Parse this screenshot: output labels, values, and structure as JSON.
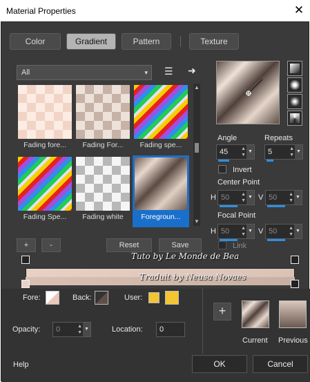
{
  "window": {
    "title": "Material Properties",
    "close_label": "✕"
  },
  "tabs": [
    {
      "label": "Color",
      "selected": false
    },
    {
      "label": "Gradient",
      "selected": true
    },
    {
      "label": "Pattern",
      "selected": false
    },
    {
      "label": "Texture",
      "selected": false
    }
  ],
  "category": {
    "value": "All",
    "caret": "▾"
  },
  "icons": {
    "library": "☰",
    "arrow": "➜"
  },
  "thumbnails": [
    {
      "label": "Fading fore...",
      "style": "fade-fore"
    },
    {
      "label": "Fading For...",
      "style": "fade-for2"
    },
    {
      "label": "Fading spe...",
      "style": "spec"
    },
    {
      "label": "Fading Spe...",
      "style": "spec"
    },
    {
      "label": "Fading white",
      "style": "fwhite"
    },
    {
      "label": "Foregroun...",
      "style": "fgrd",
      "selected": true
    }
  ],
  "controls": {
    "angle_label": "Angle",
    "angle_value": "45",
    "repeats_label": "Repeats",
    "repeats_value": "5",
    "invert_label": "Invert",
    "center_point_label": "Center Point",
    "center_h_label": "H",
    "center_h_value": "50",
    "center_v_label": "V",
    "center_v_value": "50",
    "focal_point_label": "Focal Point",
    "focal_h_label": "H",
    "focal_h_value": "50",
    "focal_v_label": "V",
    "focal_v_value": "50",
    "link_label": "Link"
  },
  "editor": {
    "add_label": "+",
    "remove_label": "-",
    "reset_label": "Reset",
    "save_label": "Save"
  },
  "watermark": {
    "line1": "Tuto by Le Monde de Bea",
    "line2": "Traduit by Neusa Novaes"
  },
  "stops": {
    "fore_label": "Fore:",
    "back_label": "Back:",
    "user_label": "User:",
    "user_color": "#f2c531",
    "opacity_label": "Opacity:",
    "opacity_value": "0",
    "location_label": "Location:",
    "location_value": "0"
  },
  "current": {
    "add_label": "+",
    "current_label": "Current",
    "previous_label": "Previous"
  },
  "footer": {
    "help_label": "Help",
    "ok_label": "OK",
    "cancel_label": "Cancel"
  },
  "colors": {
    "accent": "#1a6fcb",
    "dialog_bg": "#3a3a3a",
    "gradient_start": "#e7d0c4",
    "gradient_end": "#5e4f48"
  }
}
